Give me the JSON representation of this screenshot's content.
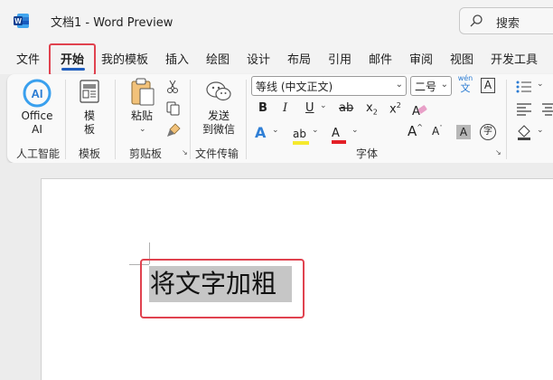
{
  "titlebar": {
    "doc_title": "文档1  -  Word Preview",
    "search_label": "搜索"
  },
  "menu": {
    "tabs": [
      "文件",
      "开始",
      "我的模板",
      "插入",
      "绘图",
      "设计",
      "布局",
      "引用",
      "邮件",
      "审阅",
      "视图",
      "开发工具"
    ]
  },
  "ribbon": {
    "office_ai": {
      "icon_text": "AI",
      "label_1": "Office",
      "label_2": "AI"
    },
    "template": {
      "label_1": "模",
      "label_2": "板"
    },
    "paste": {
      "label": "粘贴"
    },
    "send_wechat": {
      "label_1": "发送",
      "label_2": "到微信"
    },
    "font": {
      "name": "等线 (中文正文)",
      "size": "二号",
      "pinyin_top": "wén",
      "pinyin_char": "文",
      "border_char": "A",
      "bold": "B",
      "italic": "I",
      "underline": "U",
      "strike": "ab",
      "subscript": "x",
      "subscript_mark": "2",
      "superscript": "x",
      "superscript_mark": "2",
      "clear": "A",
      "effects": "A",
      "highlight": "ab",
      "color": "A",
      "grow": "A",
      "shrink": "A",
      "shading": "A",
      "enclose": "字"
    },
    "groups": {
      "ai": "人工智能",
      "template": "模板",
      "clipboard": "剪贴板",
      "file_transfer": "文件传输",
      "font": "字体"
    }
  },
  "document": {
    "selected_text": "将文字加粗"
  },
  "colors": {
    "accent_red": "#e0424f",
    "word_blue": "#1f5dbe",
    "highlight_yellow": "#f5e92d",
    "font_red": "#e31f26"
  }
}
